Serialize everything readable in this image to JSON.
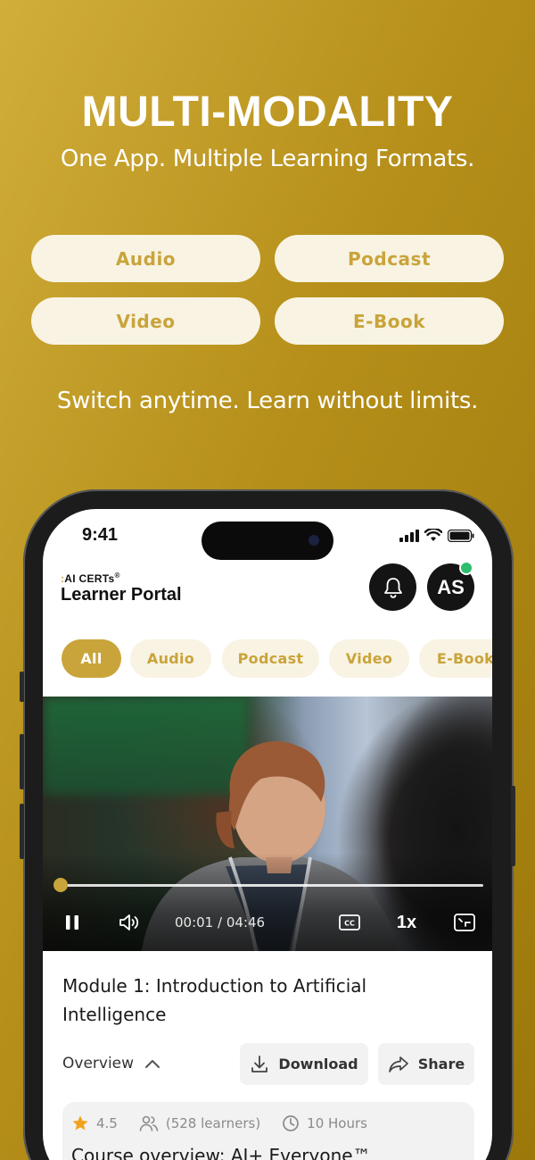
{
  "hero": {
    "title": "MULTI-MODALITY",
    "subtitle": "One App. Multiple Learning Formats."
  },
  "formats": [
    "Audio",
    "Podcast",
    "Video",
    "E-Book"
  ],
  "tagline": "Switch anytime. Learn without limits.",
  "phone": {
    "status_time": "9:41",
    "brand_small": "AI CERTs",
    "brand_small_mark": "®",
    "brand_title": "Learner Portal",
    "avatar_initials": "AS",
    "filter_chips": [
      "All",
      "Audio",
      "Podcast",
      "Video",
      "E-Book"
    ],
    "active_chip": "All",
    "player": {
      "current_time": "00:01",
      "duration": "04:46",
      "time_separator": "/",
      "speed": "1x",
      "progress_fraction": 0.004
    },
    "module_title": "Module 1: Introduction to Artificial Intelligence",
    "overview_label": "Overview",
    "download_label": "Download",
    "share_label": "Share",
    "rating": "4.5",
    "learners": "(528 learners)",
    "duration_hours": "10 Hours",
    "course_title": "Course overview: AI+ Everyone™"
  },
  "colors": {
    "accent": "#c9a43a",
    "pill_bg": "#f8f3e3",
    "dark": "#141414",
    "online": "#2dbd6e"
  }
}
